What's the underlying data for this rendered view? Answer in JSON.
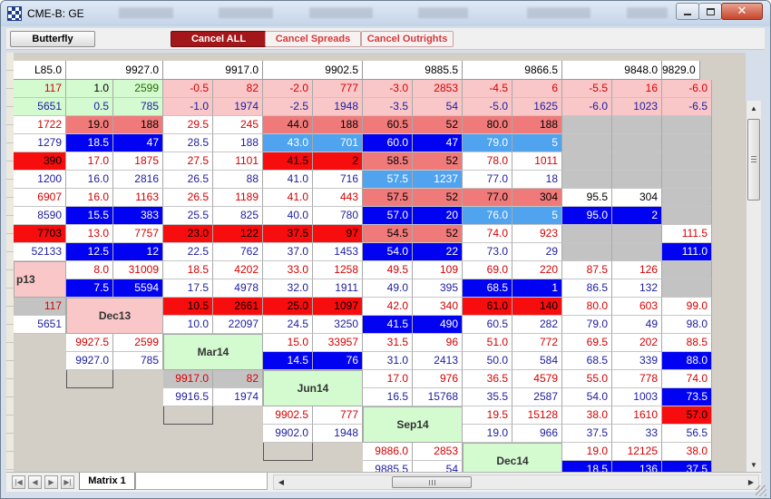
{
  "window": {
    "title": "CME-B: GE"
  },
  "toolbar": {
    "butterfly_label": "Butterfly",
    "cancel_all_label": "Cancel ALL",
    "cancel_spreads_label": "Cancel Spreads",
    "cancel_outrights_label": "Cancel Outrights"
  },
  "matrix": {
    "header_stub": "L85.0",
    "column_prices": [
      "9927.0",
      "9917.0",
      "9902.5",
      "9885.5",
      "9866.5",
      "9848.0",
      "9829.0"
    ],
    "contract_labels": [
      {
        "id": "sep13",
        "text": "p13"
      },
      {
        "id": "dec13",
        "text": "Dec13"
      },
      {
        "id": "mar14",
        "text": "Mar14"
      },
      {
        "id": "jun14",
        "text": "Jun14"
      },
      {
        "id": "sep14",
        "text": "Sep14"
      },
      {
        "id": "dec14",
        "text": "Dec14"
      }
    ],
    "rows": [
      [
        "117",
        "1.0",
        "2599",
        "-0.5",
        "82",
        "-2.0",
        "777",
        "-3.0",
        "2853",
        "-4.5",
        "6",
        "-5.5",
        "16",
        "-6.0"
      ],
      [
        "5651",
        "0.5",
        "785",
        "-1.0",
        "1974",
        "-2.5",
        "1948",
        "-3.5",
        "54",
        "-5.0",
        "1625",
        "-6.0",
        "1023",
        "-6.5"
      ],
      [
        "1722",
        "19.0",
        "188",
        "29.5",
        "245",
        "44.0",
        "188",
        "60.5",
        "52",
        "80.0",
        "188",
        "",
        "",
        ""
      ],
      [
        "1279",
        "18.5",
        "47",
        "28.5",
        "188",
        "43.0",
        "701",
        "60.0",
        "47",
        "79.0",
        "5",
        "",
        "",
        ""
      ],
      [
        "390",
        "17.0",
        "1875",
        "27.5",
        "1101",
        "41.5",
        "2",
        "58.5",
        "52",
        "78.0",
        "1011",
        "",
        "",
        ""
      ],
      [
        "1200",
        "16.0",
        "2816",
        "26.5",
        "88",
        "41.0",
        "716",
        "57.5",
        "1237",
        "77.0",
        "18",
        "",
        "",
        ""
      ],
      [
        "6907",
        "16.0",
        "1163",
        "26.5",
        "1189",
        "41.0",
        "443",
        "57.5",
        "52",
        "77.0",
        "304",
        "95.5",
        "304",
        ""
      ],
      [
        "8590",
        "15.5",
        "383",
        "25.5",
        "825",
        "40.0",
        "780",
        "57.0",
        "20",
        "76.0",
        "5",
        "95.0",
        "2",
        ""
      ],
      [
        "7703",
        "13.0",
        "7757",
        "23.0",
        "122",
        "37.5",
        "97",
        "54.5",
        "52",
        "74.0",
        "923",
        "",
        "",
        "111.5"
      ],
      [
        "52133",
        "12.5",
        "12",
        "22.5",
        "762",
        "37.0",
        "1453",
        "54.0",
        "22",
        "73.0",
        "29",
        "",
        "",
        "111.0"
      ],
      [
        "",
        "8.0",
        "31009",
        "18.5",
        "4202",
        "33.0",
        "1258",
        "49.5",
        "109",
        "69.0",
        "220",
        "87.5",
        "126",
        ""
      ],
      [
        "",
        "7.5",
        "5594",
        "17.5",
        "4978",
        "32.0",
        "1911",
        "49.0",
        "395",
        "68.5",
        "1",
        "86.5",
        "132",
        ""
      ],
      [
        "117",
        "",
        "",
        "10.5",
        "2661",
        "25.0",
        "1097",
        "42.0",
        "340",
        "61.0",
        "140",
        "80.0",
        "603",
        "99.0"
      ],
      [
        "5651",
        "",
        "",
        "10.0",
        "22097",
        "24.5",
        "3250",
        "41.5",
        "490",
        "60.5",
        "282",
        "79.0",
        "49",
        "98.0"
      ],
      [
        "",
        "9927.5",
        "2599",
        "",
        "",
        "15.0",
        "33957",
        "31.5",
        "96",
        "51.0",
        "772",
        "69.5",
        "202",
        "88.5"
      ],
      [
        "",
        "9927.0",
        "785",
        "",
        "",
        "14.5",
        "76",
        "31.0",
        "2413",
        "50.0",
        "584",
        "68.5",
        "339",
        "88.0"
      ],
      [
        "",
        "",
        "",
        "9917.0",
        "82",
        "",
        "",
        "17.0",
        "976",
        "36.5",
        "4579",
        "55.0",
        "778",
        "74.0"
      ],
      [
        "",
        "",
        "",
        "9916.5",
        "1974",
        "",
        "",
        "16.5",
        "15768",
        "35.5",
        "2587",
        "54.0",
        "1003",
        "73.5"
      ],
      [
        "",
        "",
        "",
        "",
        "",
        "9902.5",
        "777",
        "",
        "",
        "19.5",
        "15128",
        "38.0",
        "1610",
        "57.0"
      ],
      [
        "",
        "",
        "",
        "",
        "",
        "9902.0",
        "1948",
        "",
        "",
        "19.0",
        "966",
        "37.5",
        "33",
        "56.5"
      ],
      [
        "",
        "",
        "",
        "",
        "",
        "",
        "",
        "9886.0",
        "2853",
        "",
        "",
        "19.0",
        "12125",
        "38.0"
      ],
      [
        "",
        "",
        "",
        "",
        "",
        "",
        "",
        "9885.5",
        "54",
        "",
        "",
        "18.5",
        "136",
        "37.5"
      ]
    ],
    "palette": {
      "pale_green": "#d4fad0",
      "light_pink": "#f9c7c7",
      "pink": "#f07a7a",
      "red": "#f70d0d",
      "blue": "#0202f2",
      "sky_blue": "#4fa3ef",
      "gray": "#c3c3c3"
    }
  },
  "bottom": {
    "sheet_tab": "Matrix 1"
  }
}
